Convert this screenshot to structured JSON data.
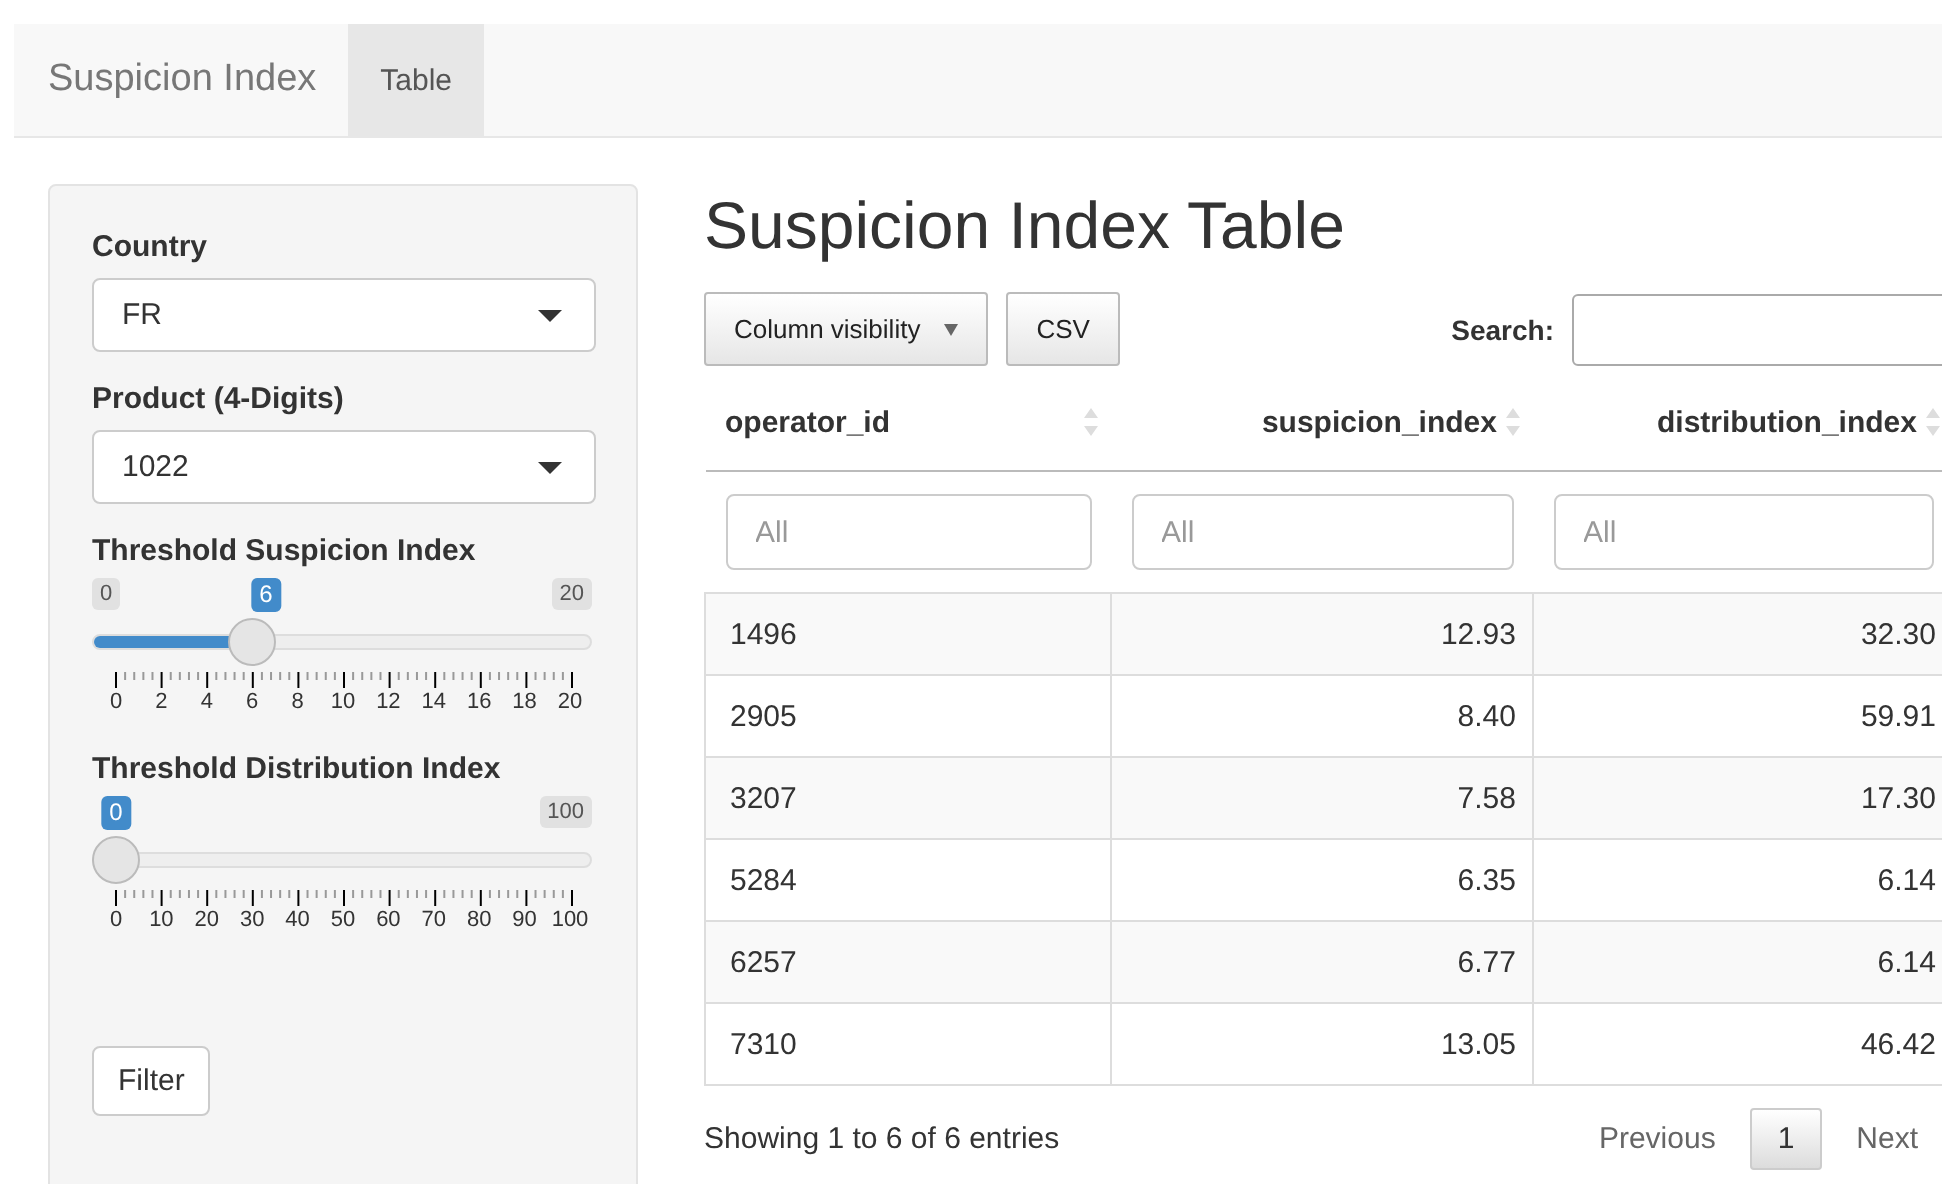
{
  "navbar": {
    "brand": "Suspicion Index",
    "tabs": [
      {
        "label": "Table",
        "selected": true
      }
    ]
  },
  "sidebar": {
    "selects": [
      {
        "label": "Country",
        "value": "FR"
      },
      {
        "label": "Product (4-Digits)",
        "value": "1022"
      }
    ],
    "sliders": [
      {
        "label": "Threshold Suspicion Index",
        "min": "0",
        "max": "20",
        "value": "6",
        "level": 0.3,
        "ticks": [
          "0",
          "2",
          "4",
          "6",
          "8",
          "10",
          "12",
          "14",
          "16",
          "18",
          "20"
        ]
      },
      {
        "label": "Threshold Distribution Index",
        "max": "100",
        "value": "0",
        "level": 0,
        "ticks": [
          "0",
          "10",
          "20",
          "30",
          "40",
          "50",
          "60",
          "70",
          "80",
          "90",
          "100"
        ]
      }
    ],
    "button": "Filter"
  },
  "main": {
    "title": "Suspicion Index Table",
    "buttons": [
      {
        "label": "Column visibility",
        "kind": "dropdown"
      },
      {
        "label": "CSV",
        "kind": "plain"
      }
    ],
    "search": {
      "label": "Search:"
    },
    "table": {
      "columns": [
        {
          "label": "operator_id",
          "kind": "text"
        },
        {
          "label": "suspicion_index",
          "kind": "number"
        },
        {
          "label": "distribution_index",
          "kind": "number"
        }
      ],
      "filters": [
        {
          "placeholder": "All"
        },
        {
          "placeholder": "All"
        },
        {
          "placeholder": "All"
        }
      ],
      "rows": [
        [
          "1496",
          "12.93",
          "32.30"
        ],
        [
          "2905",
          "8.40",
          "59.91"
        ],
        [
          "3207",
          "7.58",
          "17.30"
        ],
        [
          "5284",
          "6.35",
          "6.14"
        ],
        [
          "6257",
          "6.77",
          "6.14"
        ],
        [
          "7310",
          "13.05",
          "46.42"
        ]
      ]
    },
    "info": "Showing 1 to 6 of 6 entries",
    "pagination": [
      {
        "label": "Previous",
        "kind": "link",
        "selected": false
      },
      {
        "label": "1",
        "kind": "page",
        "selected": true
      },
      {
        "label": "Next",
        "kind": "link",
        "selected": false
      }
    ]
  }
}
